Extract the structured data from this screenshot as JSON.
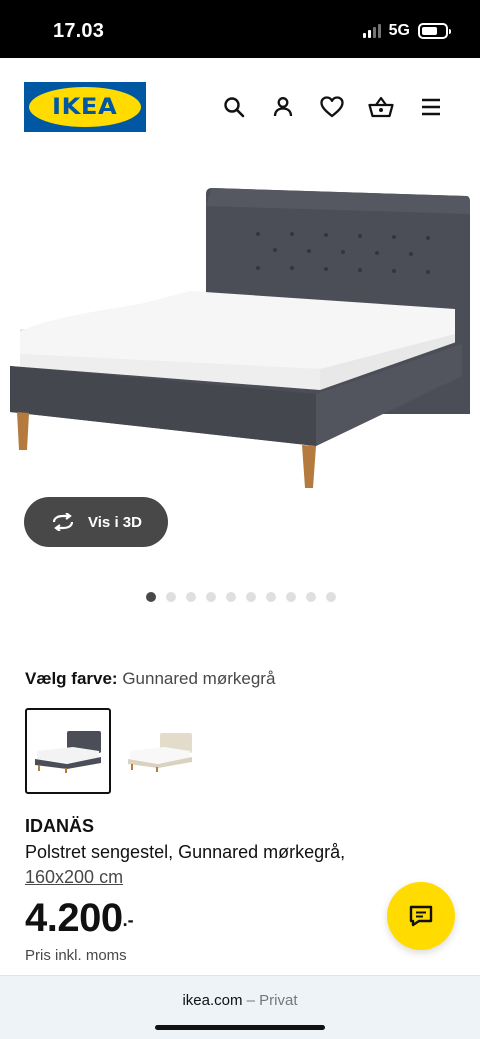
{
  "status_bar": {
    "time": "17.03",
    "network": "5G"
  },
  "header": {
    "logo_text": "IKEA"
  },
  "gallery": {
    "view_3d_label": "Vis i 3D",
    "dots_count": 10,
    "active_dot": 0
  },
  "color_select": {
    "label": "Vælg farve:",
    "value": "Gunnared mørkegrå",
    "swatches": [
      {
        "color": "dark-grey",
        "selected": true
      },
      {
        "color": "beige",
        "selected": false
      }
    ]
  },
  "product": {
    "name": "IDANÄS",
    "description": "Polstret sengestel, Gunnared mørkegrå,",
    "size": "160x200 cm",
    "price_int": "4.200",
    "price_dec": ".-",
    "price_note": "Pris inkl. moms"
  },
  "browser": {
    "domain": "ikea.com",
    "mode": "– Privat"
  },
  "colors": {
    "ikea_blue": "#0058a3",
    "ikea_yellow": "#ffdb00",
    "headboard": "#4b4e56",
    "beige": "#e3dccb"
  }
}
